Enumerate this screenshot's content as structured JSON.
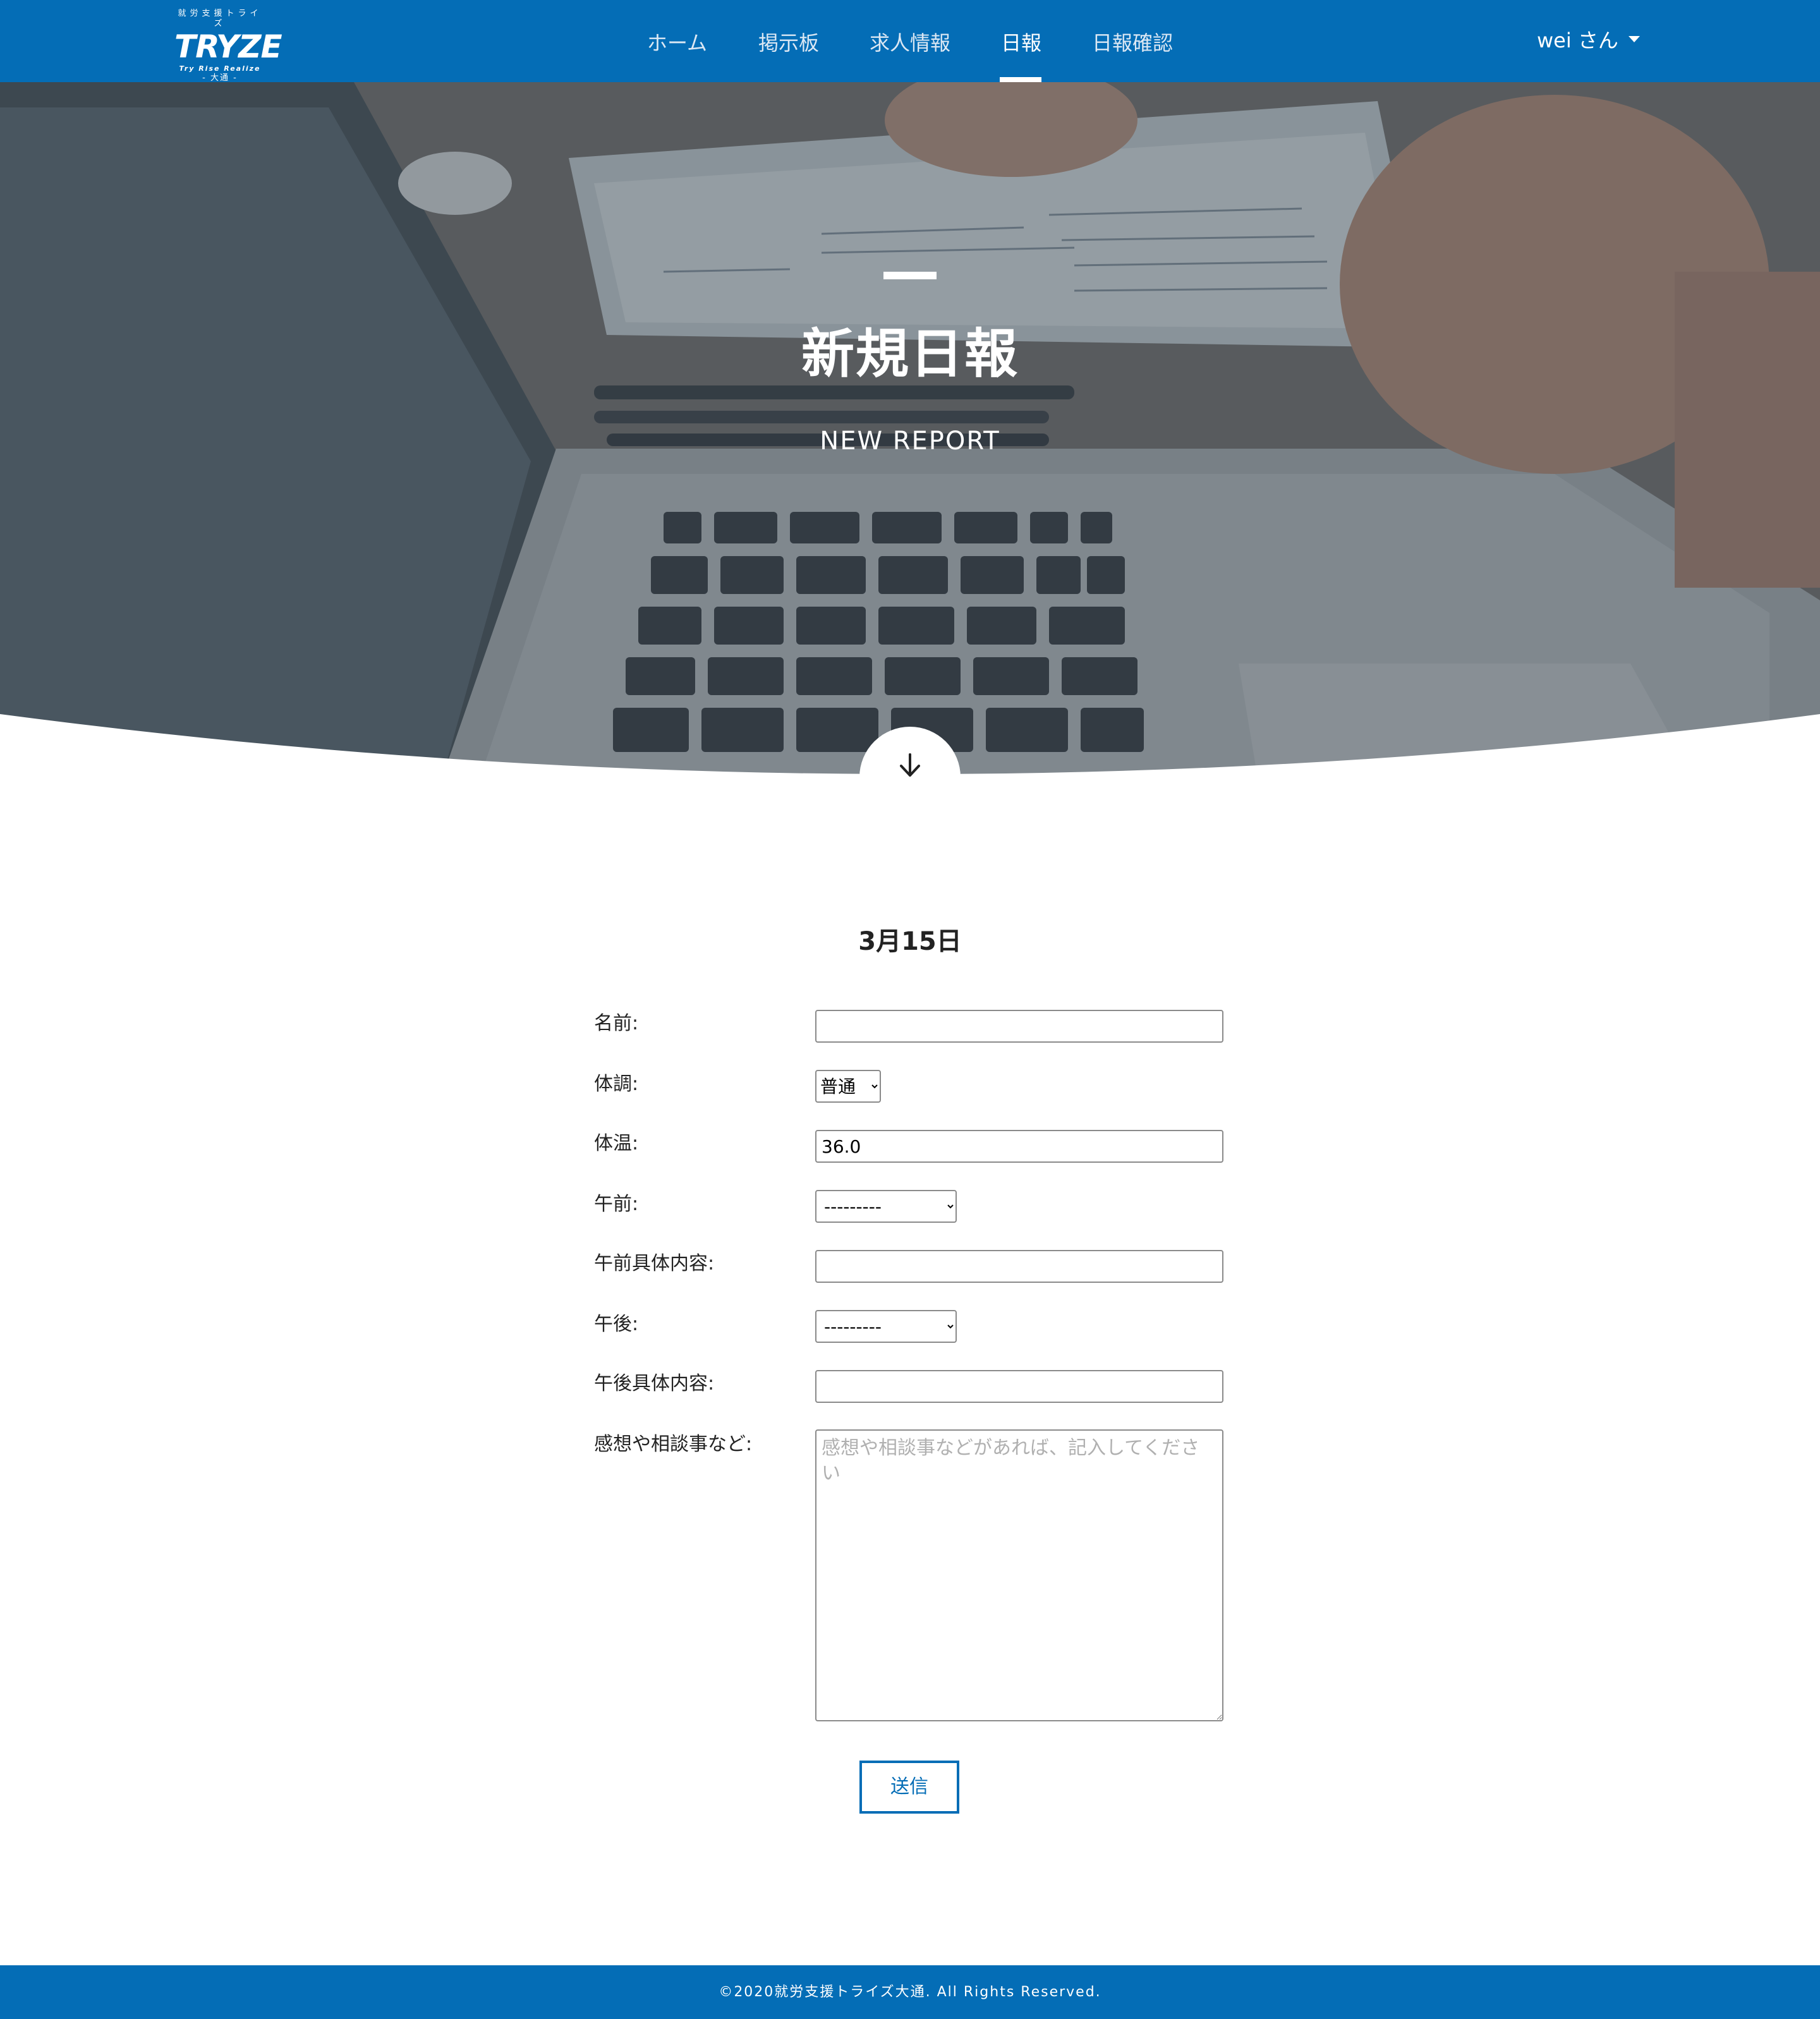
{
  "brand": {
    "tagline": "就労支援トライズ",
    "name": "TRYZE",
    "motto": "Try Rise Realize",
    "city": "- 大通 -"
  },
  "nav": {
    "items": [
      {
        "label": "ホーム"
      },
      {
        "label": "掲示板"
      },
      {
        "label": "求人情報"
      },
      {
        "label": "日報",
        "active": true
      },
      {
        "label": "日報確認"
      }
    ],
    "user": "wei さん"
  },
  "hero": {
    "title": "新規日報",
    "subtitle": "NEW REPORT"
  },
  "form": {
    "date": "3月15日",
    "fields": {
      "name": {
        "label": "名前:",
        "value": ""
      },
      "condition": {
        "label": "体調:",
        "value": "普通"
      },
      "temperature": {
        "label": "体温:",
        "value": "36.0"
      },
      "morning": {
        "label": "午前:",
        "value": "---------"
      },
      "morning_detail": {
        "label": "午前具体内容:",
        "value": ""
      },
      "afternoon": {
        "label": "午後:",
        "value": "---------"
      },
      "afternoon_detail": {
        "label": "午後具体内容:",
        "value": ""
      },
      "comments": {
        "label": "感想や相談事など:",
        "placeholder": "感想や相談事などがあれば、記入してください"
      }
    },
    "submit_label": "送信"
  },
  "footer": {
    "copyright": "©2020就労支援トライズ大通. All Rights Reserved."
  },
  "colors": {
    "brand_blue": "#046db6",
    "hero_overlay": "#4d5a63"
  },
  "icons": {
    "scroll": "arrow-down-icon",
    "user_menu": "caret-down-icon"
  }
}
